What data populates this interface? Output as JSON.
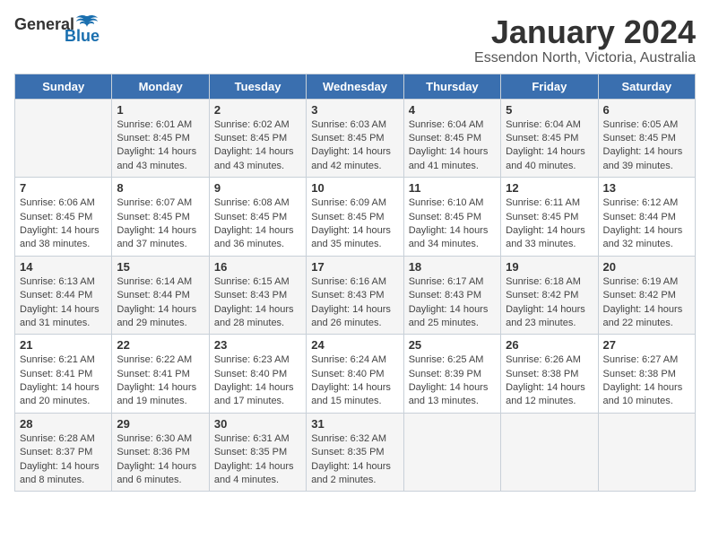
{
  "header": {
    "logo": {
      "general": "General",
      "blue": "Blue"
    },
    "title": "January 2024",
    "subtitle": "Essendon North, Victoria, Australia"
  },
  "days_of_week": [
    "Sunday",
    "Monday",
    "Tuesday",
    "Wednesday",
    "Thursday",
    "Friday",
    "Saturday"
  ],
  "weeks": [
    [
      {
        "day": "",
        "sunrise": "",
        "sunset": "",
        "daylight": ""
      },
      {
        "day": "1",
        "sunrise": "6:01 AM",
        "sunset": "8:45 PM",
        "daylight": "14 hours and 43 minutes."
      },
      {
        "day": "2",
        "sunrise": "6:02 AM",
        "sunset": "8:45 PM",
        "daylight": "14 hours and 43 minutes."
      },
      {
        "day": "3",
        "sunrise": "6:03 AM",
        "sunset": "8:45 PM",
        "daylight": "14 hours and 42 minutes."
      },
      {
        "day": "4",
        "sunrise": "6:04 AM",
        "sunset": "8:45 PM",
        "daylight": "14 hours and 41 minutes."
      },
      {
        "day": "5",
        "sunrise": "6:04 AM",
        "sunset": "8:45 PM",
        "daylight": "14 hours and 40 minutes."
      },
      {
        "day": "6",
        "sunrise": "6:05 AM",
        "sunset": "8:45 PM",
        "daylight": "14 hours and 39 minutes."
      }
    ],
    [
      {
        "day": "7",
        "sunrise": "6:06 AM",
        "sunset": "8:45 PM",
        "daylight": "14 hours and 38 minutes."
      },
      {
        "day": "8",
        "sunrise": "6:07 AM",
        "sunset": "8:45 PM",
        "daylight": "14 hours and 37 minutes."
      },
      {
        "day": "9",
        "sunrise": "6:08 AM",
        "sunset": "8:45 PM",
        "daylight": "14 hours and 36 minutes."
      },
      {
        "day": "10",
        "sunrise": "6:09 AM",
        "sunset": "8:45 PM",
        "daylight": "14 hours and 35 minutes."
      },
      {
        "day": "11",
        "sunrise": "6:10 AM",
        "sunset": "8:45 PM",
        "daylight": "14 hours and 34 minutes."
      },
      {
        "day": "12",
        "sunrise": "6:11 AM",
        "sunset": "8:45 PM",
        "daylight": "14 hours and 33 minutes."
      },
      {
        "day": "13",
        "sunrise": "6:12 AM",
        "sunset": "8:44 PM",
        "daylight": "14 hours and 32 minutes."
      }
    ],
    [
      {
        "day": "14",
        "sunrise": "6:13 AM",
        "sunset": "8:44 PM",
        "daylight": "14 hours and 31 minutes."
      },
      {
        "day": "15",
        "sunrise": "6:14 AM",
        "sunset": "8:44 PM",
        "daylight": "14 hours and 29 minutes."
      },
      {
        "day": "16",
        "sunrise": "6:15 AM",
        "sunset": "8:43 PM",
        "daylight": "14 hours and 28 minutes."
      },
      {
        "day": "17",
        "sunrise": "6:16 AM",
        "sunset": "8:43 PM",
        "daylight": "14 hours and 26 minutes."
      },
      {
        "day": "18",
        "sunrise": "6:17 AM",
        "sunset": "8:43 PM",
        "daylight": "14 hours and 25 minutes."
      },
      {
        "day": "19",
        "sunrise": "6:18 AM",
        "sunset": "8:42 PM",
        "daylight": "14 hours and 23 minutes."
      },
      {
        "day": "20",
        "sunrise": "6:19 AM",
        "sunset": "8:42 PM",
        "daylight": "14 hours and 22 minutes."
      }
    ],
    [
      {
        "day": "21",
        "sunrise": "6:21 AM",
        "sunset": "8:41 PM",
        "daylight": "14 hours and 20 minutes."
      },
      {
        "day": "22",
        "sunrise": "6:22 AM",
        "sunset": "8:41 PM",
        "daylight": "14 hours and 19 minutes."
      },
      {
        "day": "23",
        "sunrise": "6:23 AM",
        "sunset": "8:40 PM",
        "daylight": "14 hours and 17 minutes."
      },
      {
        "day": "24",
        "sunrise": "6:24 AM",
        "sunset": "8:40 PM",
        "daylight": "14 hours and 15 minutes."
      },
      {
        "day": "25",
        "sunrise": "6:25 AM",
        "sunset": "8:39 PM",
        "daylight": "14 hours and 13 minutes."
      },
      {
        "day": "26",
        "sunrise": "6:26 AM",
        "sunset": "8:38 PM",
        "daylight": "14 hours and 12 minutes."
      },
      {
        "day": "27",
        "sunrise": "6:27 AM",
        "sunset": "8:38 PM",
        "daylight": "14 hours and 10 minutes."
      }
    ],
    [
      {
        "day": "28",
        "sunrise": "6:28 AM",
        "sunset": "8:37 PM",
        "daylight": "14 hours and 8 minutes."
      },
      {
        "day": "29",
        "sunrise": "6:30 AM",
        "sunset": "8:36 PM",
        "daylight": "14 hours and 6 minutes."
      },
      {
        "day": "30",
        "sunrise": "6:31 AM",
        "sunset": "8:35 PM",
        "daylight": "14 hours and 4 minutes."
      },
      {
        "day": "31",
        "sunrise": "6:32 AM",
        "sunset": "8:35 PM",
        "daylight": "14 hours and 2 minutes."
      },
      {
        "day": "",
        "sunrise": "",
        "sunset": "",
        "daylight": ""
      },
      {
        "day": "",
        "sunrise": "",
        "sunset": "",
        "daylight": ""
      },
      {
        "day": "",
        "sunrise": "",
        "sunset": "",
        "daylight": ""
      }
    ]
  ],
  "labels": {
    "sunrise_prefix": "Sunrise: ",
    "sunset_prefix": "Sunset: ",
    "daylight_prefix": "Daylight: "
  }
}
